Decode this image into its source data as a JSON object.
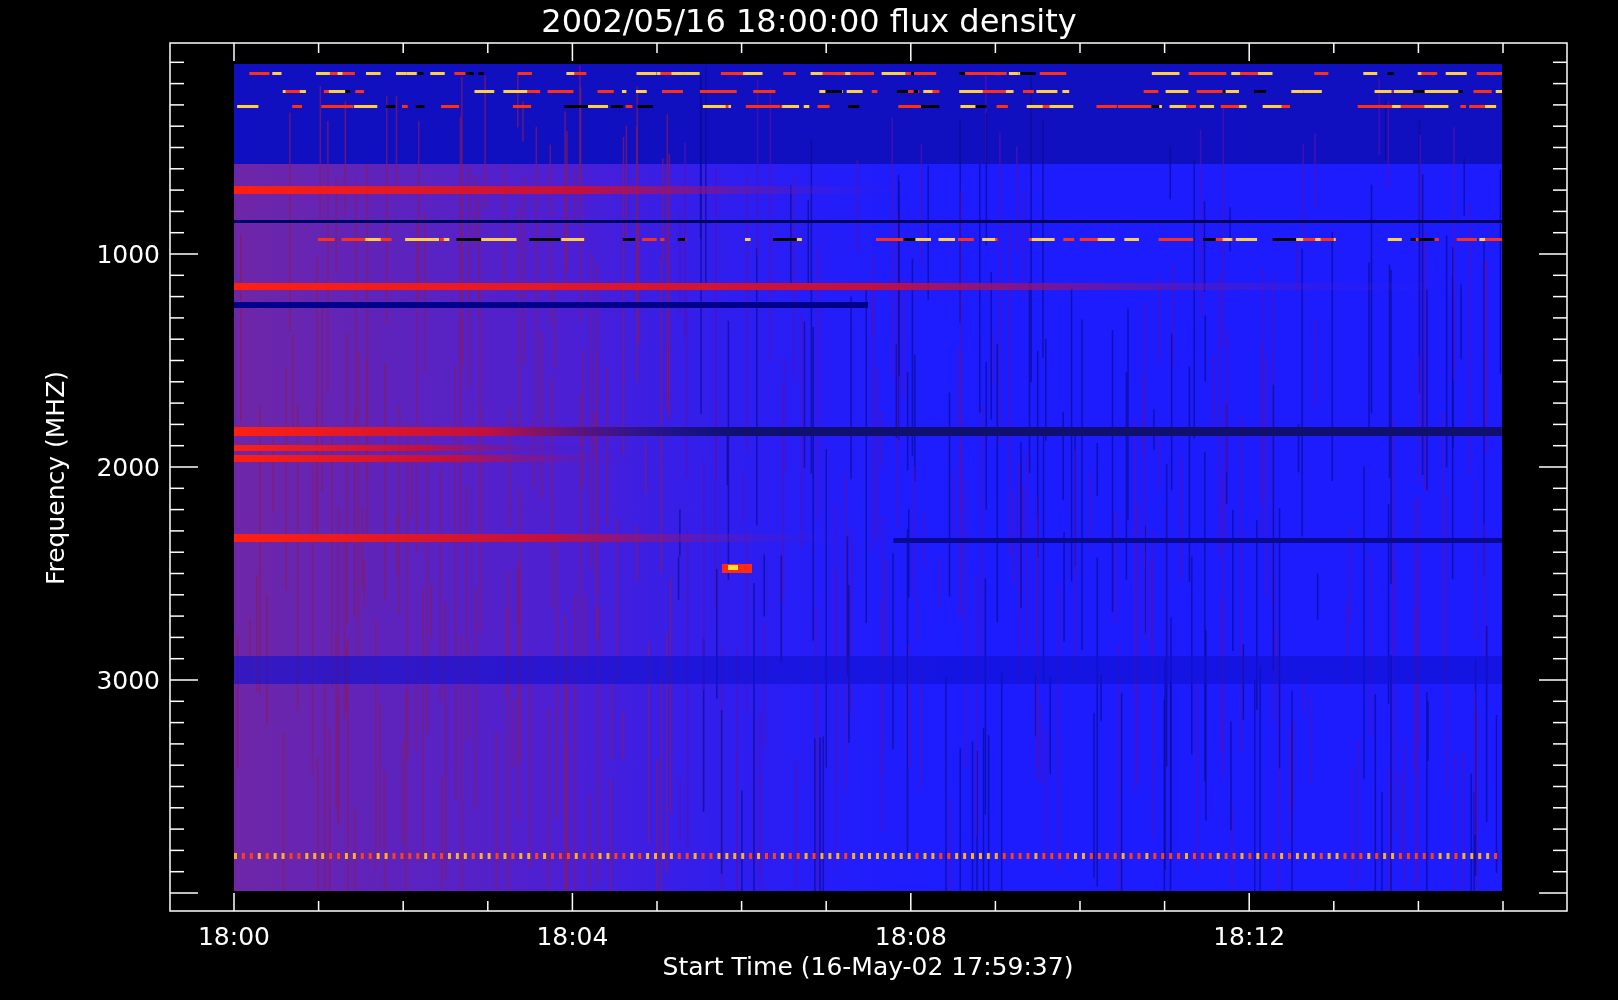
{
  "title": "2002/05/16 18:00:00 flux density",
  "y_axis": {
    "label": "Frequency (MHZ)",
    "ticks": [
      "1000",
      "2000",
      "3000"
    ]
  },
  "x_axis": {
    "label": "Start Time (16-May-02 17:59:37)",
    "ticks": [
      "18:00",
      "18:04",
      "18:08",
      "18:12"
    ]
  }
}
